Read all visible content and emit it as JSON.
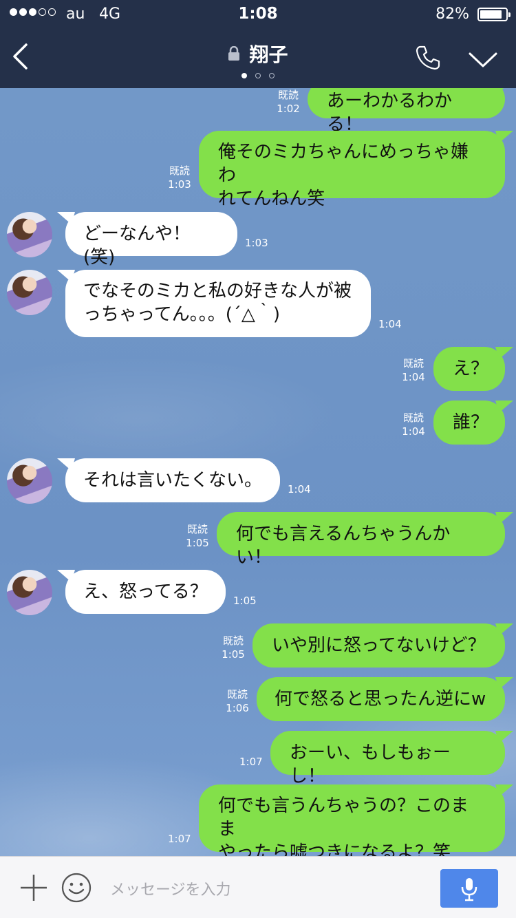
{
  "status_bar": {
    "carrier": "au",
    "network": "4G",
    "time": "1:08",
    "battery_percent": "82%",
    "battery_level": 0.82,
    "signal_bars_filled": 3,
    "signal_bars_total": 5
  },
  "header": {
    "title": "翔子",
    "page_indicator": {
      "active": 1,
      "total": 3
    },
    "back_icon": "chevron-left-icon",
    "call_icon": "phone-icon",
    "menu_icon": "chevron-down-icon"
  },
  "messages": [
    {
      "sender": "me",
      "text": "あーわかるわかる！",
      "read_label": "既読",
      "time": "1:02"
    },
    {
      "sender": "me",
      "text": "俺そのミカちゃんにめっちゃ嫌われてんねん笑",
      "line1": "俺そのミカちゃんにめっちゃ嫌わ",
      "line2": "れてんねん笑",
      "read_label": "既読",
      "time": "1:03"
    },
    {
      "sender": "them",
      "text": "どーなんや！(笑)",
      "time": "1:03"
    },
    {
      "sender": "them",
      "text": "でなそのミカと私の好きな人が被っちゃってん。。。(´△｀)",
      "line1": "でなそのミカと私の好きな人が被",
      "line2": "っちゃってん。。。(´△｀)",
      "time": "1:04"
    },
    {
      "sender": "me",
      "text": "え？",
      "read_label": "既読",
      "time": "1:04"
    },
    {
      "sender": "me",
      "text": "誰？",
      "read_label": "既読",
      "time": "1:04"
    },
    {
      "sender": "them",
      "text": "それは言いたくない。",
      "time": "1:04"
    },
    {
      "sender": "me",
      "text": "何でも言えるんちゃうんかい！",
      "read_label": "既読",
      "time": "1:05"
    },
    {
      "sender": "them",
      "text": "え、怒ってる？",
      "time": "1:05"
    },
    {
      "sender": "me",
      "text": "いや別に怒ってないけど？",
      "read_label": "既読",
      "time": "1:05"
    },
    {
      "sender": "me",
      "text": "何で怒ると思ったん逆にw",
      "read_label": "既読",
      "time": "1:06"
    },
    {
      "sender": "me",
      "text": "おーい、もしもぉーし！",
      "time": "1:07"
    },
    {
      "sender": "me",
      "text": "何でも言うんちゃうの？このままやったら嘘つきになるよ？笑",
      "line1": "何でも言うんちゃうの？このまま",
      "line2": "やったら嘘つきになるよ？笑",
      "time": "1:07"
    }
  ],
  "input_bar": {
    "placeholder": "メッセージを入力",
    "plus_icon": "plus-icon",
    "sticker_icon": "smiley-icon",
    "mic_icon": "microphone-icon",
    "mic_color": "#4f87ea"
  },
  "colors": {
    "header_bg": "#243049",
    "my_bubble": "#83e04a",
    "their_bubble": "#ffffff",
    "chat_bg": "#6f95c8"
  }
}
